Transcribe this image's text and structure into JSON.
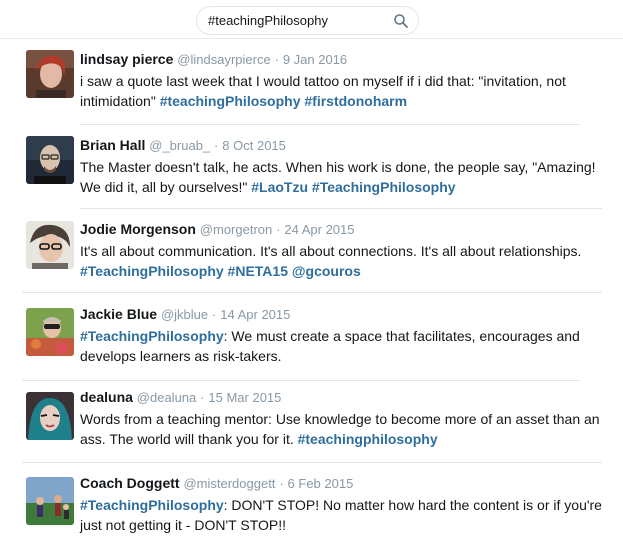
{
  "search": {
    "query": "#teachingPhilosophy"
  },
  "tweets": [
    {
      "name": "lindsay pierce",
      "handle": "@lindsayrpierce",
      "date": "9 Jan 2016",
      "parts": [
        {
          "t": "text",
          "v": "i saw a quote last week that I would tattoo on myself if i did that: \"invitation, not intimidation\" "
        },
        {
          "t": "tag",
          "v": "#teachingPhilosophy"
        },
        {
          "t": "text",
          "v": " "
        },
        {
          "t": "tag",
          "v": "#firstdonoharm"
        }
      ]
    },
    {
      "name": "Brian Hall",
      "handle": "@_bruab_",
      "date": "8 Oct 2015",
      "parts": [
        {
          "t": "text",
          "v": "The Master doesn't talk, he acts. When his work is done, the people say, \"Amazing! We did it, all by ourselves!\" "
        },
        {
          "t": "tag",
          "v": "#LaoTzu"
        },
        {
          "t": "text",
          "v": " "
        },
        {
          "t": "tag",
          "v": "#TeachingPhilosophy"
        }
      ]
    },
    {
      "name": "Jodie Morgenson",
      "handle": "@morgetron",
      "date": "24 Apr 2015",
      "parts": [
        {
          "t": "text",
          "v": "It's all about communication. It's all about connections. It's all about relationships. "
        },
        {
          "t": "tag",
          "v": "#TeachingPhilosophy"
        },
        {
          "t": "text",
          "v": " "
        },
        {
          "t": "tag",
          "v": "#NETA15"
        },
        {
          "t": "text",
          "v": " "
        },
        {
          "t": "tag",
          "v": "@gcouros"
        }
      ]
    },
    {
      "name": "Jackie Blue",
      "handle": "@jkblue",
      "date": "14 Apr 2015",
      "parts": [
        {
          "t": "tag",
          "v": "#TeachingPhilosophy"
        },
        {
          "t": "text",
          "v": ": We must create a space that facilitates, encourages and develops learners as risk-takers."
        }
      ]
    },
    {
      "name": "dealuna",
      "handle": "@dealuna",
      "date": "15 Mar 2015",
      "parts": [
        {
          "t": "text",
          "v": "Words from a teaching mentor: Use knowledge to become more of an asset than an ass. The world will thank you for it. "
        },
        {
          "t": "tag",
          "v": "#teachingphilosophy"
        }
      ]
    },
    {
      "name": "Coach Doggett",
      "handle": "@misterdoggett",
      "date": "6 Feb 2015",
      "parts": [
        {
          "t": "tag",
          "v": "#TeachingPhilosophy"
        },
        {
          "t": "text",
          "v": ": DON'T STOP! No matter how hard the content is or if you're just not getting it - DON'T STOP!!"
        }
      ]
    }
  ],
  "colors": {
    "link": "#2f6e9c",
    "meta": "#8899a6",
    "border": "#e1e8ed"
  }
}
